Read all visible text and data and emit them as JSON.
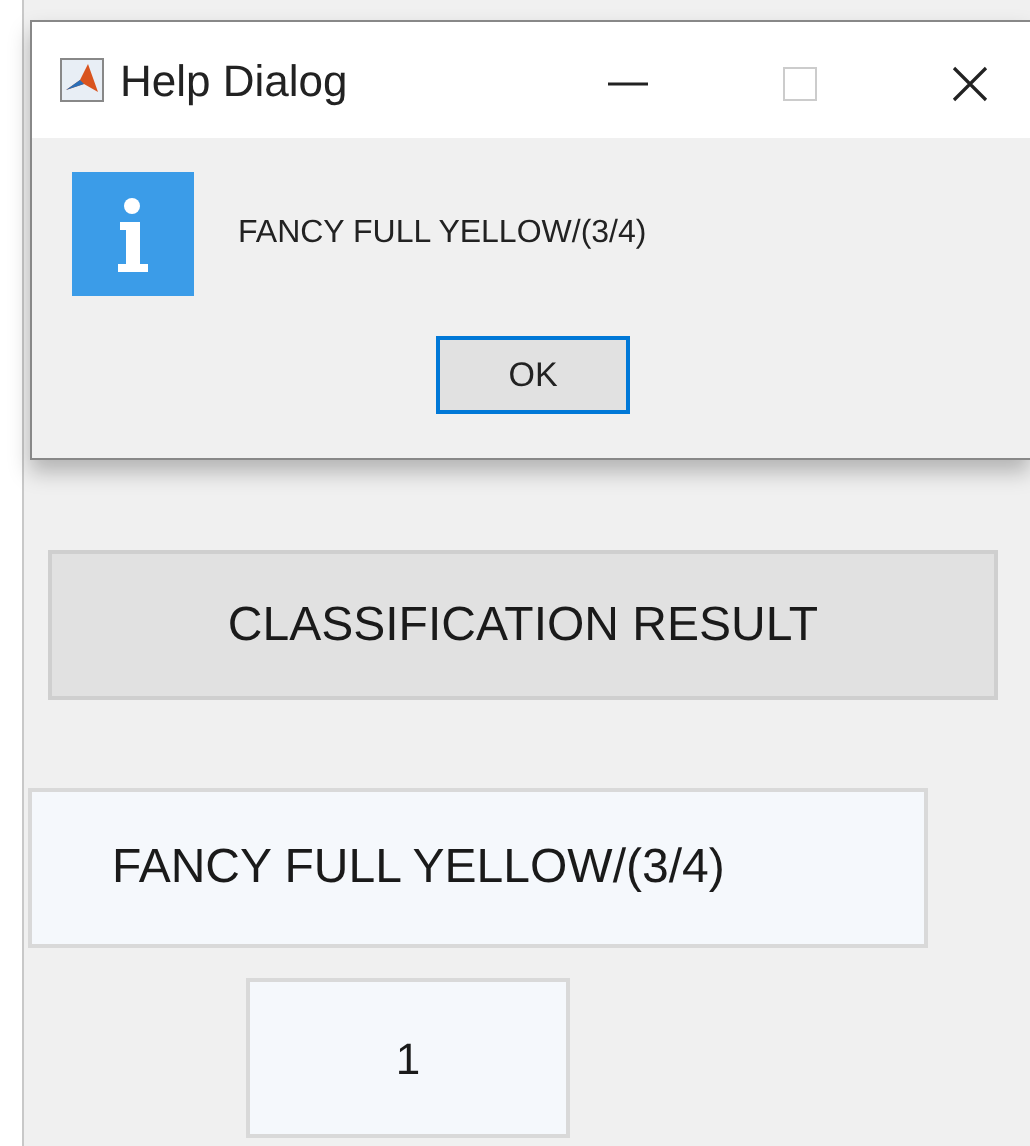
{
  "dialog": {
    "title": "Help Dialog",
    "message": "FANCY FULL YELLOW/(3/4)",
    "button": "OK"
  },
  "app": {
    "button": "CLASSIFICATION RESULT",
    "result": "FANCY FULL YELLOW/(3/4)",
    "count": "1"
  }
}
